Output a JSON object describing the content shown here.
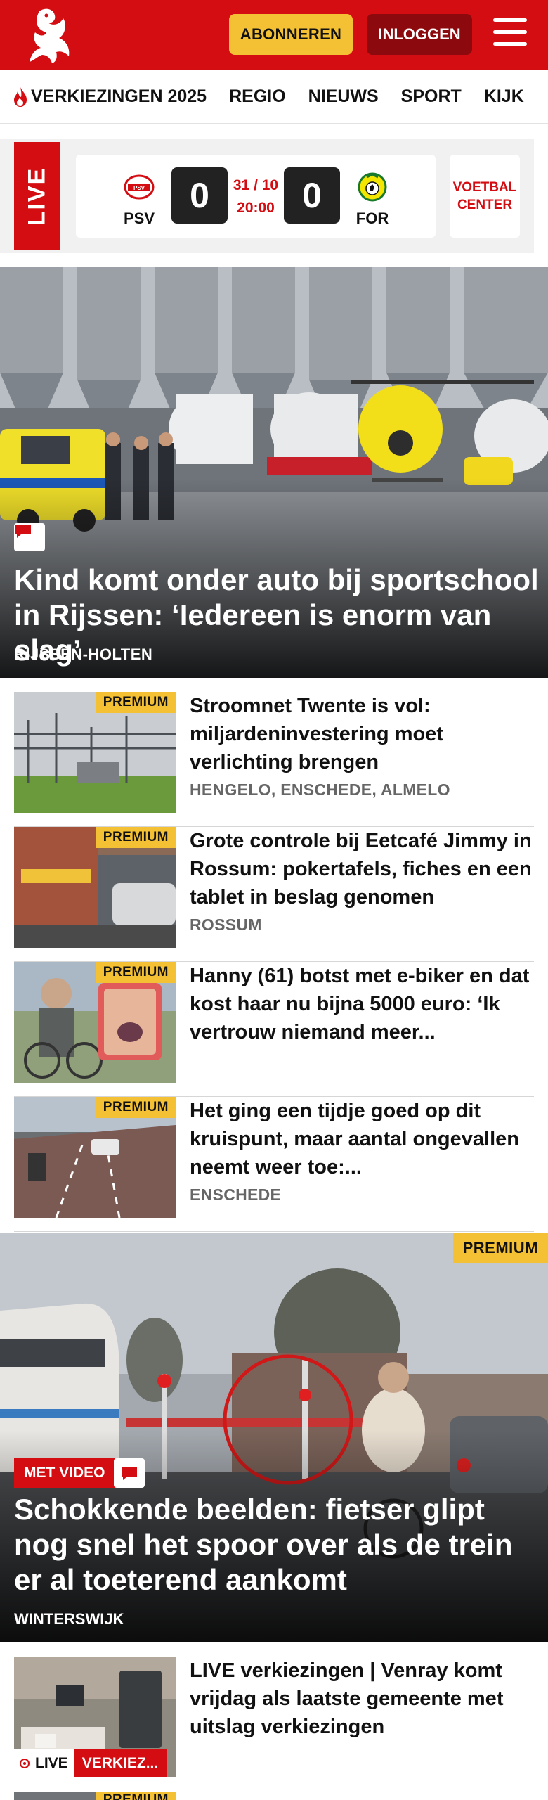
{
  "header": {
    "subscribe_label": "ABONNEREN",
    "login_label": "INLOGGEN",
    "brand_color": "#d40d12",
    "accent_color": "#f5c134"
  },
  "nav": {
    "items": [
      "VERKIEZINGEN 2025",
      "REGIO",
      "NIEUWS",
      "SPORT",
      "KIJK"
    ]
  },
  "live_match": {
    "live_label": "LIVE",
    "home_team": "PSV",
    "home_score": "0",
    "away_team": "FOR",
    "away_score": "0",
    "date": "31 / 10",
    "time": "20:00",
    "voetbal_center_line1": "VOETBAL",
    "voetbal_center_line2": "CENTER"
  },
  "hero": {
    "title": "Kind komt onder auto bij sportschool in Rijssen: ‘Iedereen is enorm van slag’",
    "location": "RIJSSEN-HOLTEN",
    "icon": "comment-icon"
  },
  "articles": [
    {
      "badge": "PREMIUM",
      "title": "Stroomnet Twente is vol: miljardeninvestering moet verlichting brengen",
      "location": "HENGELO, ENSCHEDE, ALMELO"
    },
    {
      "badge": "PREMIUM",
      "title": "Grote controle bij Eetcafé Jimmy in Rossum: pokertafels, fiches en een tablet in beslag genomen",
      "location": "ROSSUM"
    },
    {
      "badge": "PREMIUM",
      "title": "Hanny (61) botst met e-biker en dat kost haar nu bijna 5000 euro: ‘Ik vertrouw niemand meer...",
      "location": ""
    },
    {
      "badge": "PREMIUM",
      "title": "Het ging een tijdje goed op dit kruispunt, maar aantal ongevallen neemt weer toe:...",
      "location": "ENSCHEDE"
    }
  ],
  "hero2": {
    "badge": "PREMIUM",
    "video_label": "MET VIDEO",
    "title": "Schokkende beelden: fietser glipt nog snel het spoor over als de trein er al toeterend aankomt",
    "location": "WINTERSWIJK"
  },
  "live_article": {
    "title": "LIVE verkiezingen | Venray komt vrijdag als laatste gemeente met uitslag verkiezingen",
    "live_label": "LIVE",
    "category_label": "VERKIEZ..."
  },
  "next_article": {
    "badge": "PREMIUM"
  }
}
